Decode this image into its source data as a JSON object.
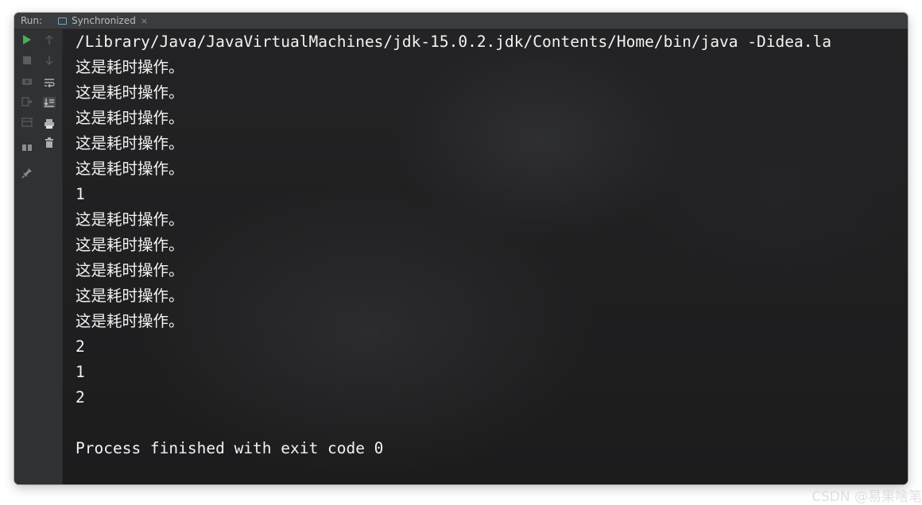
{
  "titlebar": {
    "run_label": "Run:",
    "tab_label": "Synchronized",
    "tab_close": "×"
  },
  "console": {
    "lines": [
      "/Library/Java/JavaVirtualMachines/jdk-15.0.2.jdk/Contents/Home/bin/java -Didea.la",
      "这是耗时操作。",
      "这是耗时操作。",
      "这是耗时操作。",
      "这是耗时操作。",
      "这是耗时操作。",
      "1",
      "这是耗时操作。",
      "这是耗时操作。",
      "这是耗时操作。",
      "这是耗时操作。",
      "这是耗时操作。",
      "2",
      "1",
      "2",
      "",
      "Process finished with exit code 0"
    ]
  },
  "watermark": "CSDN @易果啥笔",
  "icons": [
    "run-icon",
    "stop-icon",
    "up-icon",
    "camera-icon",
    "down-icon",
    "exit-icon",
    "soft-wrap-icon",
    "layout-icon",
    "scroll-to-end-icon",
    "print-icon",
    "trash-icon",
    "pin-icon"
  ]
}
